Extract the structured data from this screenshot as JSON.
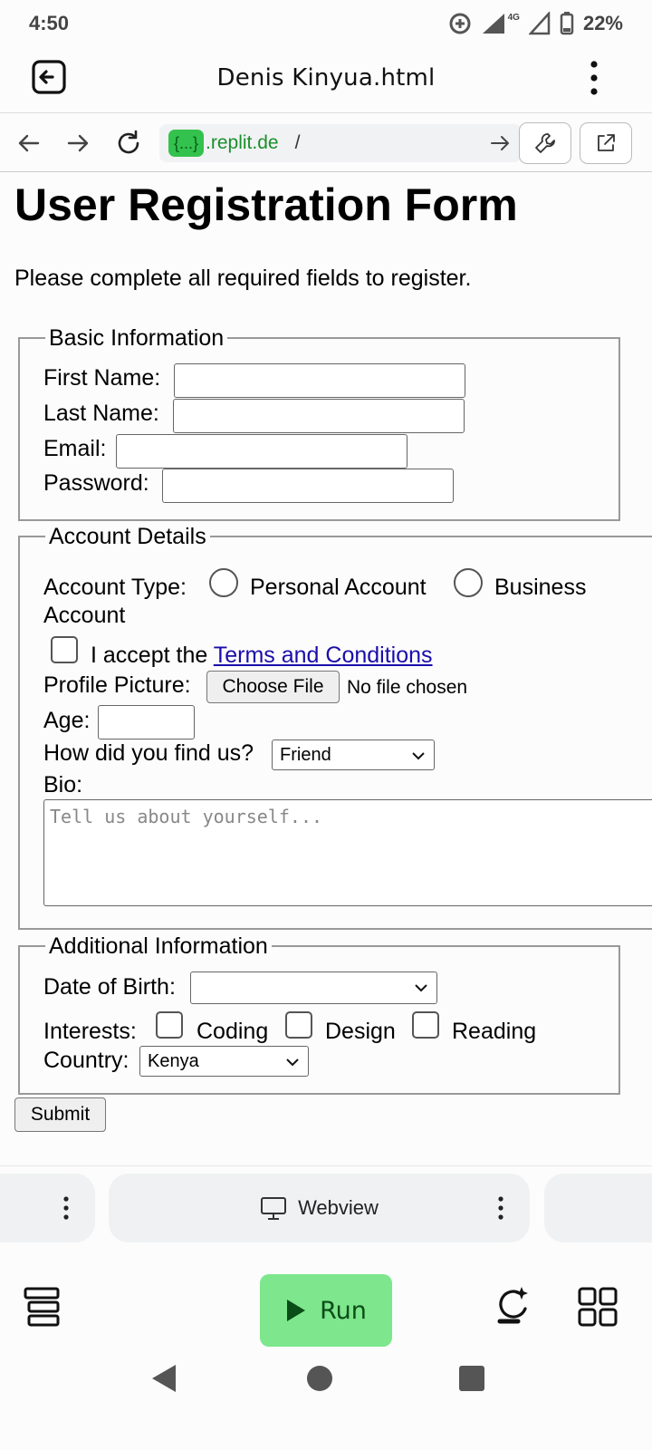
{
  "status_bar": {
    "time": "4:50",
    "network": "4G",
    "battery": "22%"
  },
  "header": {
    "title": "Denis Kinyua.html"
  },
  "url_bar": {
    "badge": "{...}",
    "domain": ".replit.de",
    "path": "/"
  },
  "page": {
    "title": "User Registration Form",
    "intro": "Please complete all required fields to register.",
    "basic": {
      "legend": "Basic Information",
      "first_name_label": "First Name:",
      "last_name_label": "Last Name:",
      "email_label": "Email:",
      "password_label": "Password:"
    },
    "account": {
      "legend": "Account Details",
      "type_label": "Account Type:",
      "personal_label": "Personal Account",
      "business_label_line1": "Business",
      "business_label_line2": "Account",
      "terms_prefix": "I accept the ",
      "terms_link": "Terms and Conditions",
      "picture_label": "Profile Picture:",
      "choose_file": "Choose File",
      "no_file": "No file chosen",
      "age_label": "Age:",
      "find_label": "How did you find us?",
      "find_selected": "Friend",
      "bio_label": "Bio:",
      "bio_placeholder": "Tell us about yourself..."
    },
    "additional": {
      "legend": "Additional Information",
      "dob_label": "Date of Birth:",
      "dob_value": "",
      "interests_label": "Interests:",
      "interest_1": "Coding",
      "interest_2": "Design",
      "interest_3": "Reading",
      "country_label": "Country:",
      "country_selected": "Kenya"
    },
    "submit_label": "Submit"
  },
  "tabs": {
    "webview_label": "Webview"
  },
  "bottom": {
    "run_label": "Run"
  },
  "colors": {
    "run_bg": "#7ee68d",
    "url_badge": "#33c24d",
    "link": "#1a0dab"
  }
}
